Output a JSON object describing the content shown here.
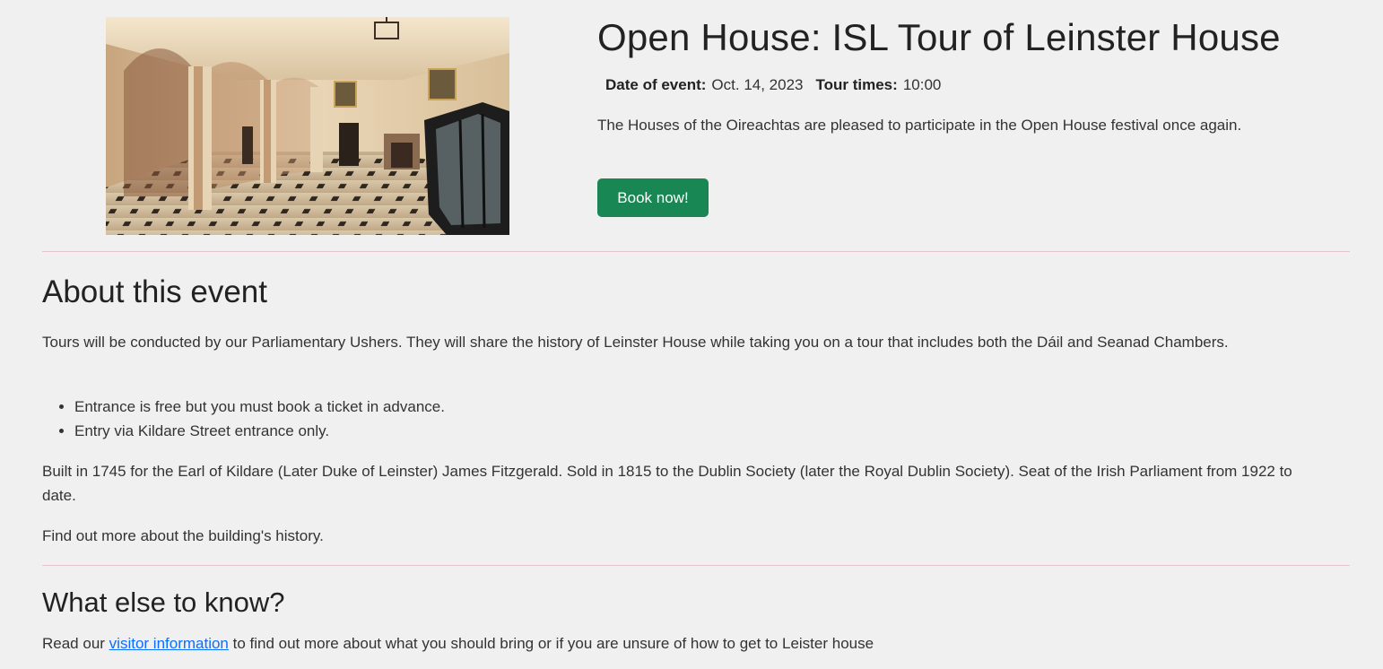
{
  "event": {
    "title": "Open House: ISL Tour of Leinster House",
    "date_label": "Date of event:",
    "date_value": "Oct. 14, 2023",
    "times_label": "Tour times:",
    "times_value": "10:00",
    "intro": "The Houses of the Oireachtas are pleased to participate in the Open House festival once again.",
    "book_label": "Book now!"
  },
  "about": {
    "heading": "About this event",
    "paragraph1": "Tours will be conducted by our Parliamentary Ushers. They will share the history of Leinster House while taking you on a tour that includes both the Dáil and Seanad Chambers.",
    "bullets": [
      "Entrance is free but you must book a ticket in advance.",
      "Entry via Kildare Street entrance only."
    ],
    "paragraph2": "Built in 1745 for the Earl of Kildare (Later Duke of Leinster) James Fitzgerald. Sold in 1815 to the Dublin Society (later the Royal Dublin Society). Seat of the Irish Parliament from 1922 to date.",
    "paragraph3": "Find out more about the building's history."
  },
  "else": {
    "heading": "What else to know?",
    "text_before": "Read our ",
    "link_text": "visitor information",
    "text_after": " to find out more about what you should bring or if you are unsure of how to get to Leister house"
  },
  "colors": {
    "background": "#f0f0f0",
    "button": "#198754",
    "divider": "#e3c3cc",
    "link": "#0d6efd"
  },
  "icons": {
    "hero": "interior-hall-photo"
  }
}
